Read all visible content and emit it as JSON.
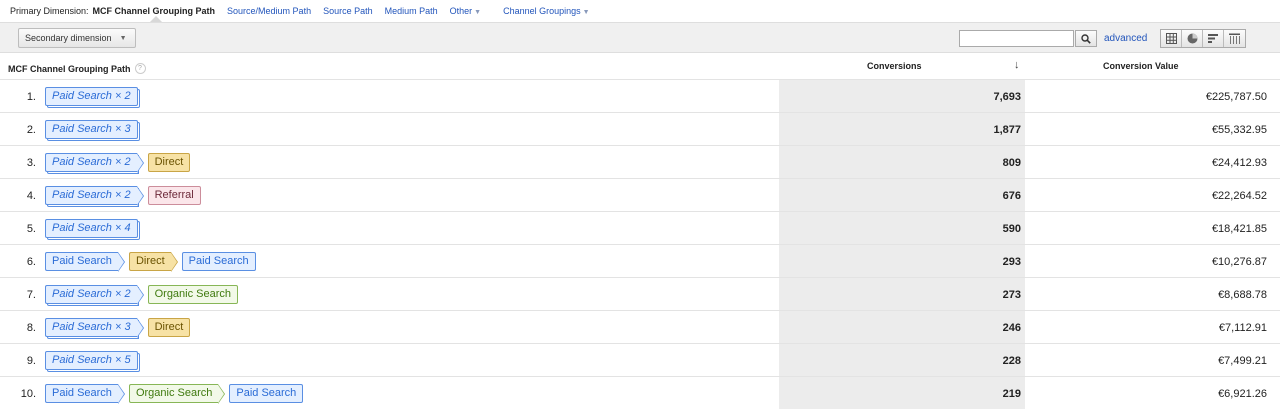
{
  "primary_dimension": {
    "label": "Primary Dimension:",
    "active": "MCF Channel Grouping Path",
    "links": [
      "Source/Medium Path",
      "Source Path",
      "Medium Path"
    ],
    "other": "Other",
    "channel_groupings": "Channel Groupings"
  },
  "toolbar": {
    "secondary_dimension": "Secondary dimension",
    "search_value": "",
    "advanced": "advanced",
    "views": [
      "table-view-icon",
      "pie-view-icon",
      "bar-view-icon",
      "pivot-view-icon"
    ]
  },
  "table": {
    "columns": [
      "MCF Channel Grouping Path",
      "Conversions",
      "Conversion Value"
    ],
    "help": "?",
    "sort_indicator": "↓",
    "rows": [
      {
        "num": "1.",
        "path": [
          {
            "label": "Paid Search × 2",
            "type": "ps",
            "italic": true
          }
        ],
        "conversions": "7,693",
        "value": "€225,787.50"
      },
      {
        "num": "2.",
        "path": [
          {
            "label": "Paid Search × 3",
            "type": "ps",
            "italic": true
          }
        ],
        "conversions": "1,877",
        "value": "€55,332.95"
      },
      {
        "num": "3.",
        "path": [
          {
            "label": "Paid Search × 2",
            "type": "ps",
            "italic": true
          },
          {
            "label": "Direct",
            "type": "dir"
          }
        ],
        "conversions": "809",
        "value": "€24,412.93"
      },
      {
        "num": "4.",
        "path": [
          {
            "label": "Paid Search × 2",
            "type": "ps",
            "italic": true
          },
          {
            "label": "Referral",
            "type": "ref"
          }
        ],
        "conversions": "676",
        "value": "€22,264.52"
      },
      {
        "num": "5.",
        "path": [
          {
            "label": "Paid Search × 4",
            "type": "ps",
            "italic": true
          }
        ],
        "conversions": "590",
        "value": "€18,421.85"
      },
      {
        "num": "6.",
        "path": [
          {
            "label": "Paid Search",
            "type": "ps"
          },
          {
            "label": "Direct",
            "type": "dir"
          },
          {
            "label": "Paid Search",
            "type": "ps"
          }
        ],
        "conversions": "293",
        "value": "€10,276.87"
      },
      {
        "num": "7.",
        "path": [
          {
            "label": "Paid Search × 2",
            "type": "ps",
            "italic": true
          },
          {
            "label": "Organic Search",
            "type": "org"
          }
        ],
        "conversions": "273",
        "value": "€8,688.78"
      },
      {
        "num": "8.",
        "path": [
          {
            "label": "Paid Search × 3",
            "type": "ps",
            "italic": true
          },
          {
            "label": "Direct",
            "type": "dir"
          }
        ],
        "conversions": "246",
        "value": "€7,112.91"
      },
      {
        "num": "9.",
        "path": [
          {
            "label": "Paid Search × 5",
            "type": "ps",
            "italic": true
          }
        ],
        "conversions": "228",
        "value": "€7,499.21"
      },
      {
        "num": "10.",
        "path": [
          {
            "label": "Paid Search",
            "type": "ps"
          },
          {
            "label": "Organic Search",
            "type": "org"
          },
          {
            "label": "Paid Search",
            "type": "ps"
          }
        ],
        "conversions": "219",
        "value": "€6,921.26"
      }
    ]
  },
  "colors": {
    "link": "#2255bb",
    "paid_search": "#2a6bd6",
    "direct": "#f7e2a5",
    "referral": "#fbe6ea",
    "organic_search": "#3f7a0e"
  }
}
